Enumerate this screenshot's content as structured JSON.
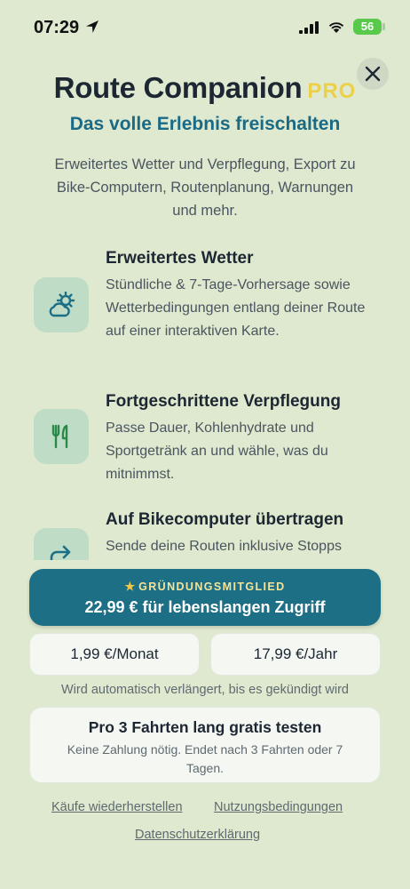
{
  "status_bar": {
    "time": "07:29",
    "battery": "56"
  },
  "header": {
    "app_name": "Route Companion",
    "tier": "PRO",
    "subtitle": "Das volle Erlebnis freischalten",
    "description": "Erweitertes Wetter und Verpflegung, Export zu Bike-Computern, Routenplanung, Warnungen und mehr."
  },
  "features": [
    {
      "title": "Erweitertes Wetter",
      "text": "Stündliche & 7-Tage-Vorhersage sowie Wetterbedingungen entlang deiner Route auf einer interaktiven Karte.",
      "icon": "weather-icon"
    },
    {
      "title": "Fortgeschrittene Verpflegung",
      "text": "Passe Dauer, Kohlenhydrate und Sportgetränk an und wähle, was du mitnimmst.",
      "icon": "fork-knife-icon"
    },
    {
      "title": "Auf Bikecomputer übertragen",
      "text": "Sende deine Routen inklusive Stopps",
      "icon": "share-arrow-icon"
    }
  ],
  "offers": {
    "lifetime_badge": "GRÜNDUNGSMITGLIED",
    "lifetime_price": "22,99 € für lebenslangen Zugriff",
    "monthly": "1,99 €/Monat",
    "yearly": "17,99 €/Jahr",
    "renew_note": "Wird automatisch verlängert, bis es gekündigt wird",
    "trial_title": "Pro 3 Fahrten lang gratis testen",
    "trial_note": "Keine Zahlung nötig. Endet nach 3 Fahrten oder 7 Tagen."
  },
  "links": {
    "restore": "Käufe wiederherstellen",
    "terms": "Nutzungsbedingungen",
    "privacy": "Datenschutzerklärung"
  },
  "colors": {
    "background": "#dfe9cf",
    "accent": "#1d6f86",
    "pro": "#ecd04a",
    "icon_bg": "#bfdcc6"
  }
}
